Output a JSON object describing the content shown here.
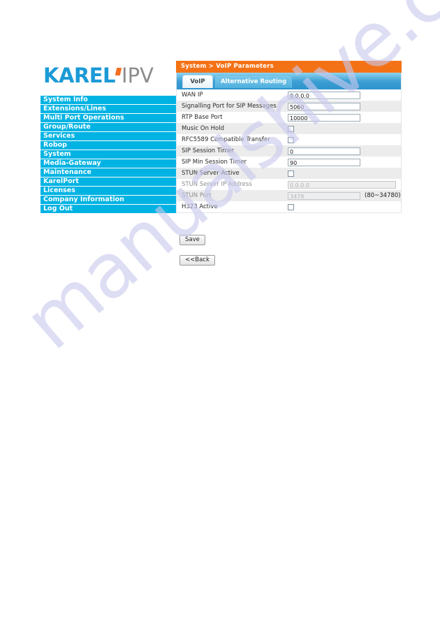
{
  "brand": {
    "logo_primary": "KAREL",
    "logo_secondary": "IPV",
    "primary_color": "#1b9ad6",
    "secondary_color": "#8c8c8c",
    "accent_color": "#f36f21"
  },
  "watermark": {
    "text": "manualshive.com",
    "color": "#c9c9ee"
  },
  "sidebar": {
    "background_color": "#00b3e3",
    "items": [
      {
        "label": "System Info"
      },
      {
        "label": "Extensions/Lines"
      },
      {
        "label": "Multi Port Operations"
      },
      {
        "label": "Group/Route"
      },
      {
        "label": "Services"
      },
      {
        "label": "Robop"
      },
      {
        "label": "System"
      },
      {
        "label": "Media-Gateway"
      },
      {
        "label": "Maintenance"
      },
      {
        "label": "KarelPort"
      },
      {
        "label": "Licenses"
      },
      {
        "label": "Company Information"
      },
      {
        "label": "Log Out"
      }
    ]
  },
  "panel": {
    "breadcrumb": "System > VoIP Parameters",
    "header_color": "#f47216",
    "tabs": [
      {
        "label": "VoIP",
        "active": true
      },
      {
        "label": "Alternative Routing",
        "active": false
      }
    ],
    "form_rows": [
      {
        "label": "WAN IP",
        "type": "text",
        "value": "0.0.0.0"
      },
      {
        "label": "Signalling Port for SIP Messages",
        "type": "text",
        "value": "5060"
      },
      {
        "label": "RTP Base Port",
        "type": "text",
        "value": "10000"
      },
      {
        "label": "Music On Hold",
        "type": "checkbox",
        "value": ""
      },
      {
        "label": "RFC5589 Compatible Transfer",
        "type": "checkbox",
        "value": ""
      },
      {
        "label": "SIP Session Timer",
        "type": "text",
        "value": "0"
      },
      {
        "label": "SIP Min Session Timer",
        "type": "text",
        "value": "90"
      },
      {
        "label": "STUN Server Active",
        "type": "checkbox",
        "value": ""
      },
      {
        "label": "STUN Server IP Address",
        "type": "text-disabled-wide",
        "value": "0.0.0.0"
      },
      {
        "label": "STUN Port",
        "type": "text-disabled",
        "value": "3478",
        "hint": "(80~34780)"
      },
      {
        "label": "H323 Active",
        "type": "checkbox",
        "value": ""
      }
    ],
    "buttons": {
      "save_label": "Save",
      "back_label": "<<Back"
    }
  }
}
